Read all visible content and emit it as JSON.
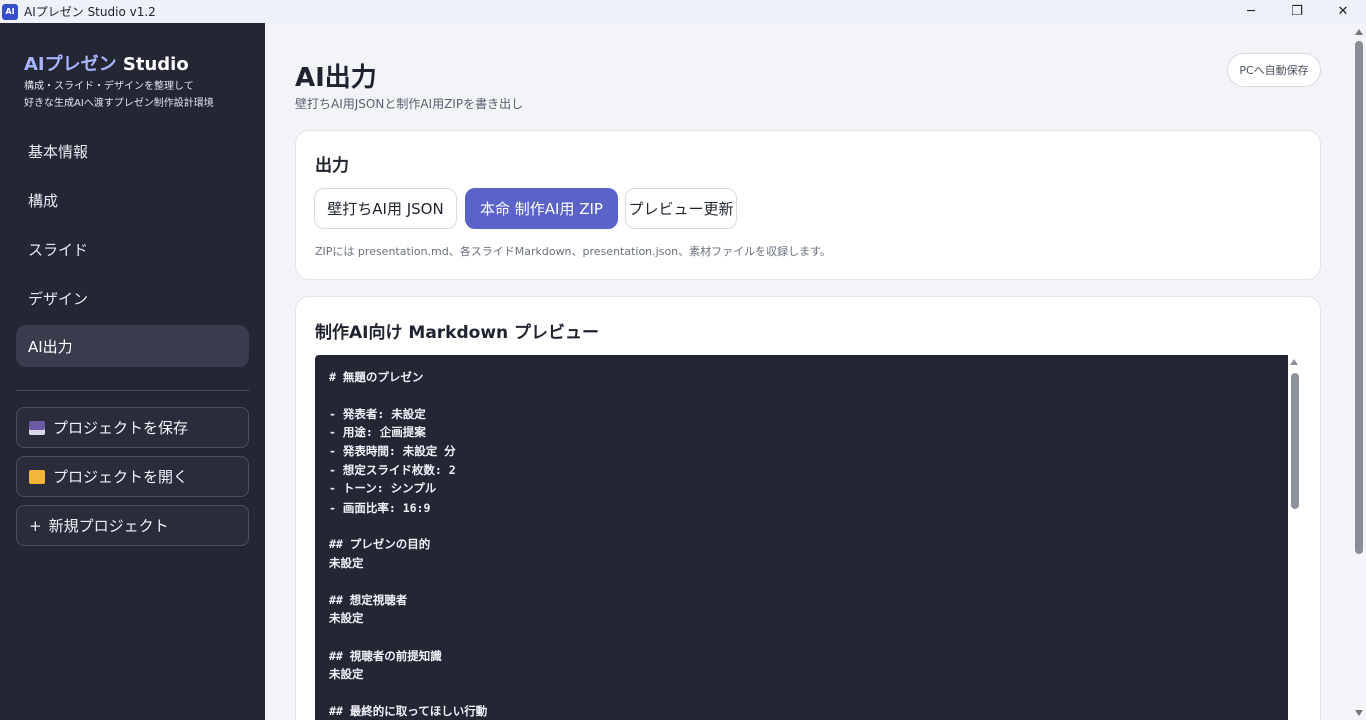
{
  "window": {
    "title": "AIプレゼン Studio v1.2",
    "icon_name": "app-icon",
    "icon_text": "AI",
    "controls": {
      "minimize": "─",
      "maximize": "❐",
      "close": "✕"
    }
  },
  "sidebar": {
    "brand_accent": "AIプレゼン",
    "brand_rest": " Studio",
    "tagline_line1": "構成・スライド・デザインを整理して",
    "tagline_line2": "好きな生成AIへ渡すプレゼン制作設計環境",
    "nav": [
      {
        "label": "基本情報"
      },
      {
        "label": "構成"
      },
      {
        "label": "スライド"
      },
      {
        "label": "デザイン"
      },
      {
        "label": "AI出力",
        "active": true
      }
    ],
    "actions": [
      {
        "label": "プロジェクトを保存",
        "icon": "floppy-disk-icon"
      },
      {
        "label": "プロジェクトを開く",
        "icon": "folder-icon"
      },
      {
        "label": "新規プロジェクト",
        "icon": "plus-icon",
        "glyph": "+"
      }
    ]
  },
  "main": {
    "title": "AI出力",
    "subtitle": "壁打ちAI用JSONと制作AI用ZIPを書き出し",
    "autosave_label": "PCへ自動保存",
    "output_card": {
      "title": "出力",
      "buttons": [
        {
          "label": "壁打ちAI用 JSON"
        },
        {
          "label": "本命 制作AI用 ZIP",
          "primary": true
        },
        {
          "label": "プレビュー更新"
        }
      ],
      "note": "ZIPには presentation.md、各スライドMarkdown、presentation.json、素材ファイルを収録します。"
    },
    "preview_card": {
      "title": "制作AI向け Markdown プレビュー",
      "lines": [
        "# 無題のプレゼン",
        "",
        "- 発表者: 未設定",
        "- 用途: 企画提案",
        "- 発表時間: 未設定 分",
        "- 想定スライド枚数: 2",
        "- トーン: シンプル",
        "- 画面比率: 16:9",
        "",
        "## プレゼンの目的",
        "未設定",
        "",
        "## 想定視聴者",
        "未設定",
        "",
        "## 視聴者の前提知識",
        "未設定",
        "",
        "## 最終的に取ってほしい行動"
      ]
    }
  },
  "colors": {
    "sidebar_bg": "#242634",
    "accent": "#5a63c8",
    "brand_accent": "#a9b4ff",
    "code_bg": "#242634"
  }
}
